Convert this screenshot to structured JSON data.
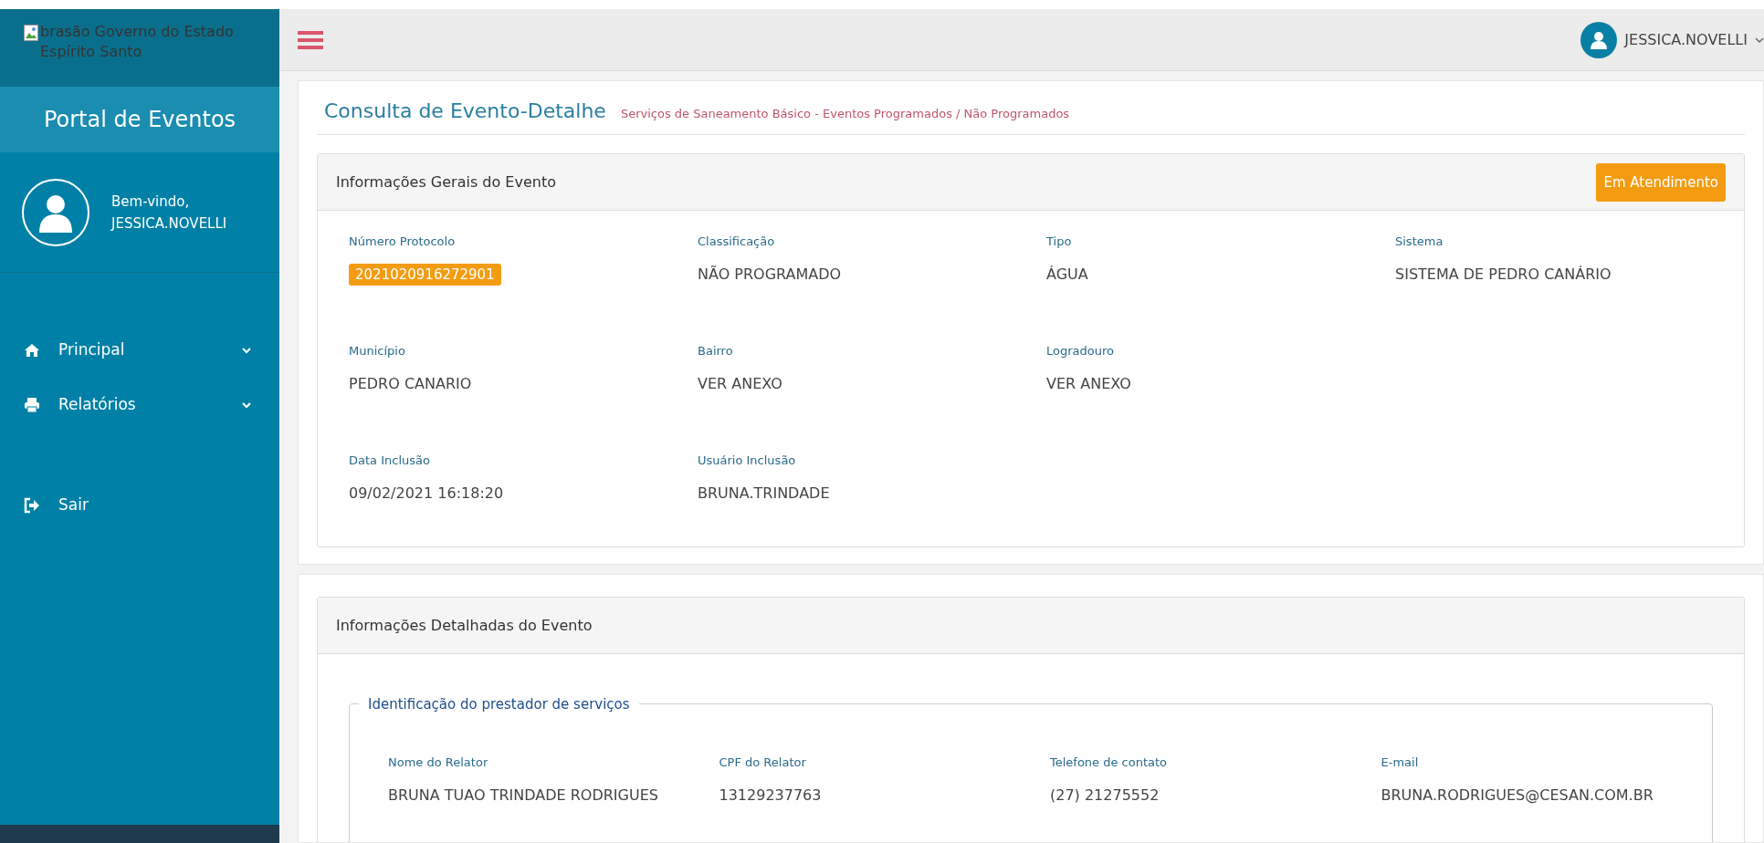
{
  "logo": {
    "alt_text": "brasão Governo do Estado Espírito Santo"
  },
  "sidebar": {
    "title": "Portal de Eventos",
    "welcome": "Bem-vindo,",
    "user": "JESSICA.NOVELLI",
    "menu": [
      {
        "label": "Principal",
        "kind": "home",
        "expandable": true
      },
      {
        "label": "Relatórios",
        "kind": "printer",
        "expandable": true
      },
      {
        "label": "Sair",
        "kind": "exit",
        "expandable": false
      }
    ]
  },
  "topbar": {
    "user": "JESSICA.NOVELLI"
  },
  "page": {
    "title": "Consulta de Evento-Detalhe",
    "subtitle": "Serviços de Saneamento Básico - Eventos Programados / Não Programados"
  },
  "general": {
    "title": "Informações Gerais do Evento",
    "status": "Em Atendimento",
    "rows": [
      [
        {
          "label": "Número Protocolo",
          "value": "2021020916272901",
          "kind": "badge"
        },
        {
          "label": "Classificação",
          "value": "NÃO PROGRAMADO",
          "kind": "text"
        },
        {
          "label": "Tipo",
          "value": "ÁGUA",
          "kind": "text"
        },
        {
          "label": "Sistema",
          "value": "SISTEMA DE PEDRO CANÁRIO",
          "kind": "text"
        }
      ],
      [
        {
          "label": "Município",
          "value": "PEDRO CANARIO",
          "kind": "text"
        },
        {
          "label": "Bairro",
          "value": "VER ANEXO",
          "kind": "text"
        },
        {
          "label": "Logradouro",
          "value": "VER ANEXO",
          "kind": "text"
        }
      ],
      [
        {
          "label": "Data Inclusão",
          "value": "09/02/2021 16:18:20",
          "kind": "text"
        },
        {
          "label": "Usuário Inclusão",
          "value": "BRUNA.TRINDADE",
          "kind": "text"
        }
      ]
    ]
  },
  "detailed": {
    "title": "Informações Detalhadas do Evento",
    "legend": "Identificação do prestador de serviços",
    "rows": [
      [
        {
          "label": "Nome do Relator",
          "value": "BRUNA TUAO TRINDADE RODRIGUES",
          "kind": "text"
        },
        {
          "label": "CPF do Relator",
          "value": "13129237763",
          "kind": "text"
        },
        {
          "label": "Telefone de contato",
          "value": "(27) 21275552",
          "kind": "text"
        },
        {
          "label": "E-mail",
          "value": "BRUNA.RODRIGUES@CESAN.COM.BR",
          "kind": "text"
        }
      ]
    ]
  }
}
